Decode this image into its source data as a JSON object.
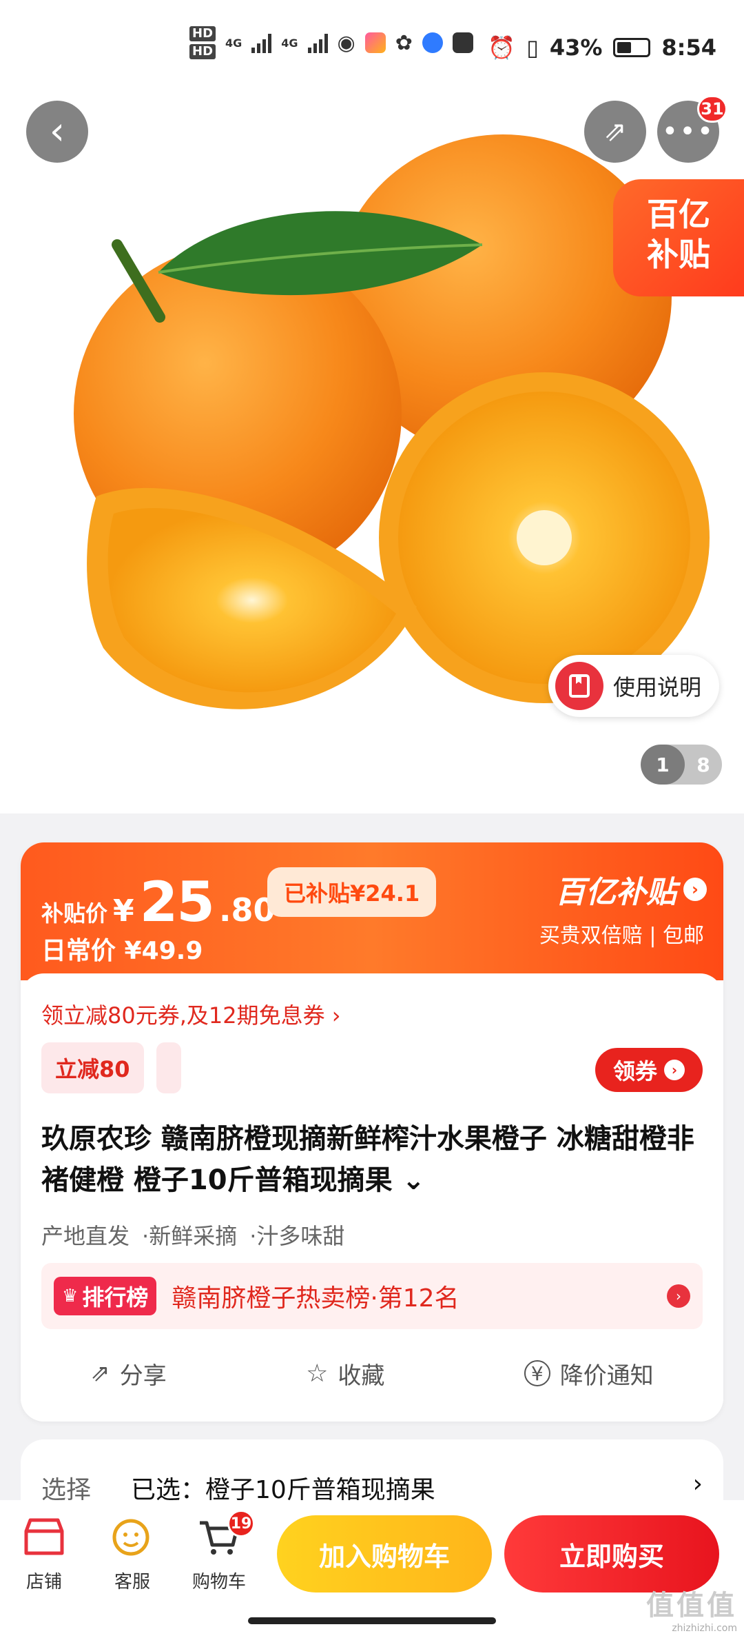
{
  "status_bar": {
    "hd1": "HD",
    "hd2": "HD",
    "net1": "4G",
    "net2": "4G",
    "battery_pct": "43%",
    "time": "8:54"
  },
  "header": {
    "notification_count": "31"
  },
  "hero": {
    "subsidy_tag_line1": "百亿",
    "subsidy_tag_line2": "补贴",
    "usage_label": "使用说明",
    "pager_current": "1",
    "pager_total": "8"
  },
  "price": {
    "subsidy_label": "补贴价",
    "yen": "¥",
    "integer": "25",
    "decimal": ".80",
    "subsidized_amount": "已补贴¥24.1",
    "regular_label": "日常价 ¥49.9",
    "brand": "百亿补贴",
    "brand_sub": "买贵双倍赔 | 包邮"
  },
  "coupon": {
    "link": "领立减80元券,及12期免息券 ›",
    "chip": "立减80",
    "get_button": "领券"
  },
  "product": {
    "title": "玖原农珍 赣南脐橙现摘新鲜榨汁水果橙子 冰糖甜橙非褚健橙 橙子10斤普箱现摘果 ⌄",
    "tags": [
      "产地直发",
      "·新鲜采摘",
      "·汁多味甜"
    ],
    "rank_badge": "排行榜",
    "rank_text": "赣南脐橙子热卖榜·第12名"
  },
  "actions": {
    "share": "分享",
    "favorite": "收藏",
    "price_alert": "降价通知"
  },
  "select": {
    "label": "选择",
    "value": "已选：橙子10斤普箱现摘果",
    "arrow": "›"
  },
  "bottom_nav": {
    "store": "店铺",
    "service": "客服",
    "cart": "购物车",
    "cart_count": "19",
    "add_to_cart": "加入购物车",
    "buy_now": "立即购买"
  },
  "watermark": {
    "brand": "值值值",
    "site": "zhizhizhi.com"
  },
  "colors": {
    "accent_red": "#e8231e",
    "orange": "#ff5a1e",
    "yellow": "#ffc21c"
  }
}
